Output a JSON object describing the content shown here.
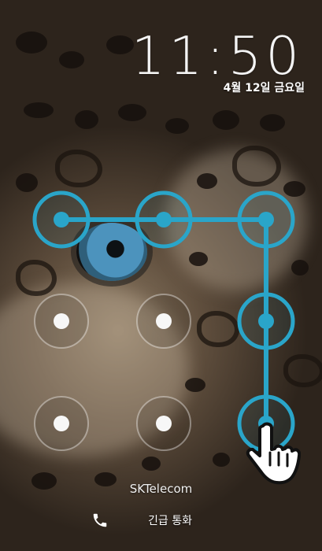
{
  "clock": {
    "time": "11:50",
    "date": "4월 12일 금요일"
  },
  "pattern": {
    "dots": [
      {
        "row": 1,
        "col": 1,
        "selected": true
      },
      {
        "row": 1,
        "col": 2,
        "selected": true
      },
      {
        "row": 1,
        "col": 3,
        "selected": true
      },
      {
        "row": 2,
        "col": 1,
        "selected": false
      },
      {
        "row": 2,
        "col": 2,
        "selected": false
      },
      {
        "row": 2,
        "col": 3,
        "selected": true
      },
      {
        "row": 3,
        "col": 1,
        "selected": false
      },
      {
        "row": 3,
        "col": 2,
        "selected": false
      },
      {
        "row": 3,
        "col": 3,
        "selected": true
      }
    ],
    "accent_color": "#2aa5c9"
  },
  "carrier": "SKTelecom",
  "emergency_call": {
    "label": "긴급 통화",
    "icon": "phone-icon"
  },
  "gesture": {
    "icon": "hand-pointer-icon"
  }
}
